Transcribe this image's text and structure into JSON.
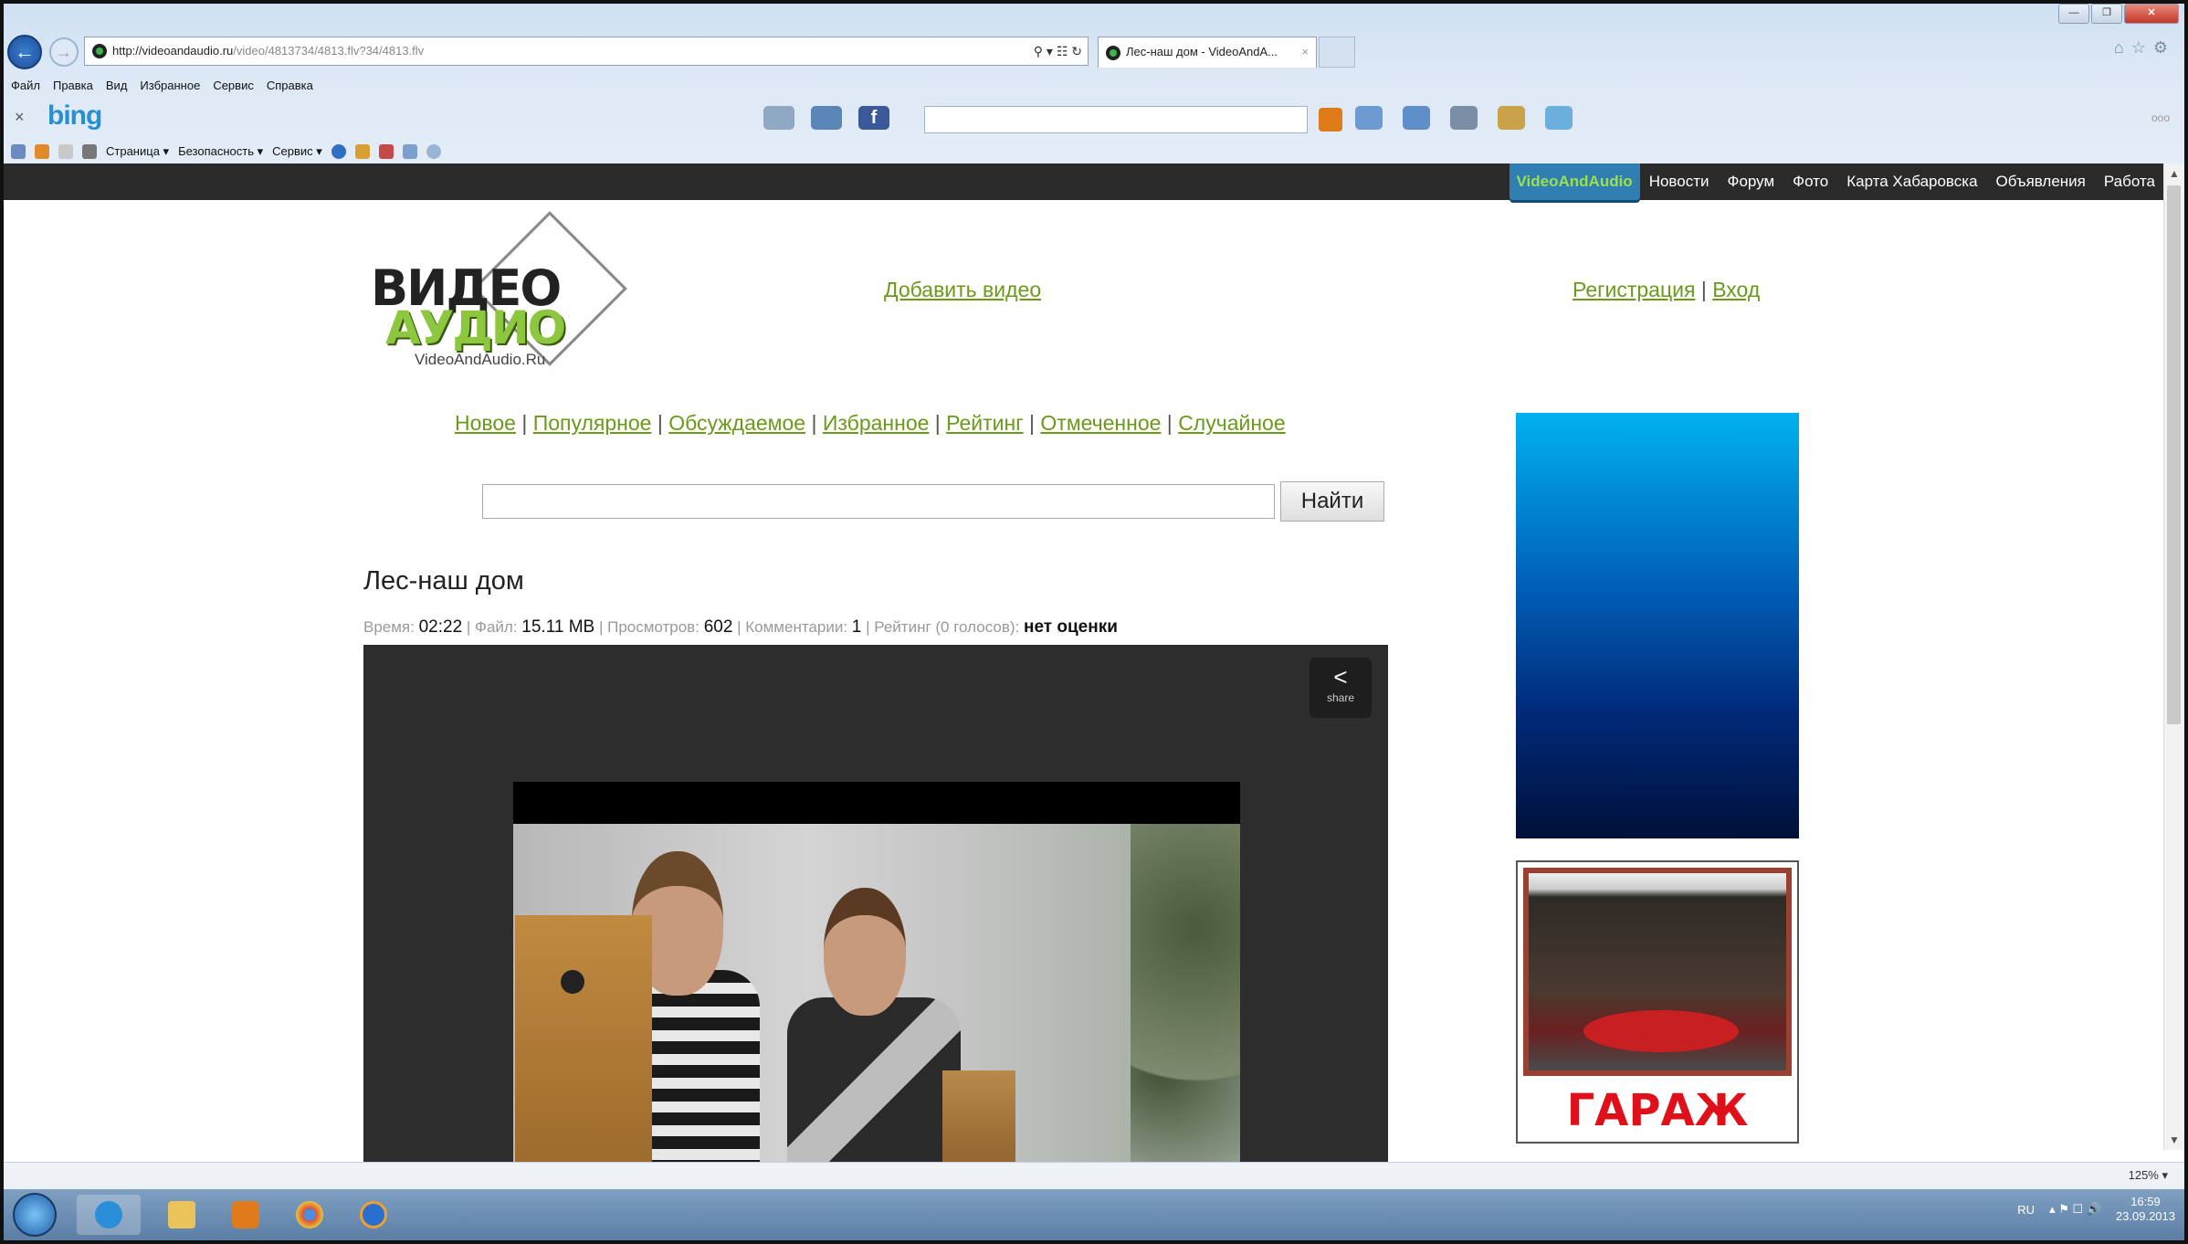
{
  "browser": {
    "url_host": "http://videoandaudio.ru",
    "url_path": "/video/4813734/4813.flv?34/4813.flv",
    "tab_title": "Лес-наш дом - VideoAndA...",
    "tab_close": "×",
    "window_controls": {
      "minimize": "—",
      "restore": "❐",
      "close": "✕"
    },
    "menu": [
      "Файл",
      "Правка",
      "Вид",
      "Избранное",
      "Сервис",
      "Справка"
    ],
    "bing_logo": "bing",
    "bing_close": "×",
    "bing_more": "ооо",
    "commands": [
      "Страница ▾",
      "Безопасность ▾",
      "Сервис ▾"
    ],
    "status_zoom": "125% ▾"
  },
  "site_nav": {
    "items": [
      "VideoAndAudio",
      "Новости",
      "Форум",
      "Фото",
      "Карта Хабаровска",
      "Объявления",
      "Работа"
    ]
  },
  "header": {
    "logo_line1": "ВИДЕО",
    "logo_line2": "АУДИО",
    "logo_site": "VideoAndAudio.Ru",
    "add_video": "Добавить видео",
    "register": "Регистрация",
    "login": "Вход",
    "auth_sep": "|"
  },
  "categories": [
    "Новое",
    "Популярное",
    "Обсуждаемое",
    "Избранное",
    "Рейтинг",
    "Отмеченное",
    "Случайное"
  ],
  "search": {
    "placeholder": "",
    "button": "Найти"
  },
  "video": {
    "title": "Лес-наш дом",
    "time_label": "Время:",
    "time": "02:22",
    "file_label": "Файл:",
    "file": "15.11 MB",
    "views_label": "Просмотров:",
    "views": "602",
    "comments_label": "Комментарии:",
    "comments": "1",
    "rating_label": "Рейтинг (0 голосов):",
    "rating": "нет оценки",
    "share_label": "share"
  },
  "ads": {
    "garage_label": "ГАРАЖ"
  },
  "taskbar": {
    "lang": "RU",
    "time": "16:59",
    "date": "23.09.2013"
  }
}
